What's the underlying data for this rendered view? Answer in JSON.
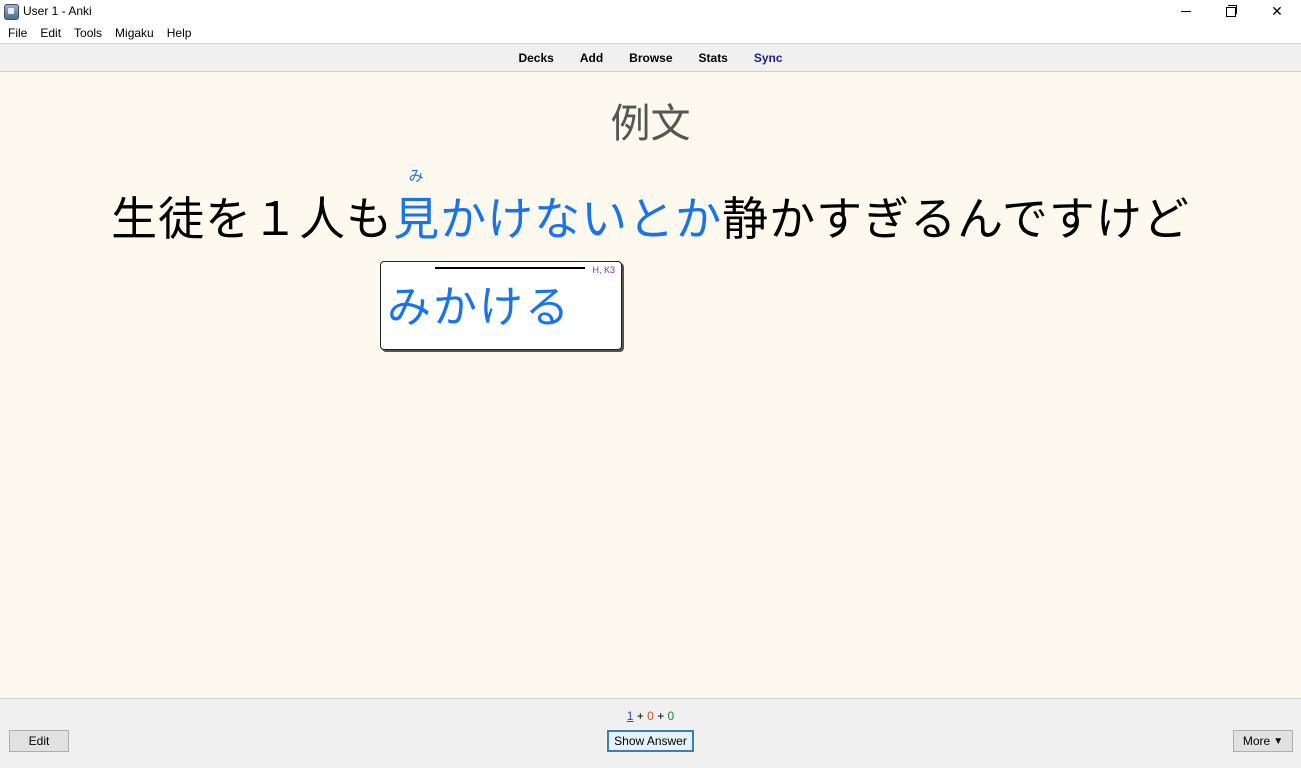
{
  "window": {
    "title": "User 1 - Anki",
    "controls": {
      "minimize": "minimize-icon",
      "maximize": "restore-icon",
      "close": "close-icon"
    }
  },
  "menu": [
    "File",
    "Edit",
    "Tools",
    "Migaku",
    "Help"
  ],
  "toolbar": {
    "links": [
      "Decks",
      "Add",
      "Browse",
      "Stats",
      "Sync"
    ]
  },
  "card": {
    "heading": "例文",
    "sentence": {
      "before": "生徒を１人も",
      "furigana_base": "見",
      "furigana": "み",
      "highlight_rest": "かけないとか",
      "after": "静かすぎるんですけど"
    },
    "popup": {
      "tag": "H, K3",
      "word": "みかける"
    }
  },
  "colors": {
    "card_background": "#fdf9ee",
    "highlight": "#1a73e8",
    "sync_link": "#1d1d8c"
  },
  "bottom": {
    "counts": {
      "new": "1",
      "learn": "0",
      "review": "0",
      "sep": "+"
    },
    "edit_label": "Edit",
    "show_answer_label": "Show Answer",
    "more_label": "More",
    "more_icon": "triangle-down-icon",
    "more_arrow": "▼"
  }
}
